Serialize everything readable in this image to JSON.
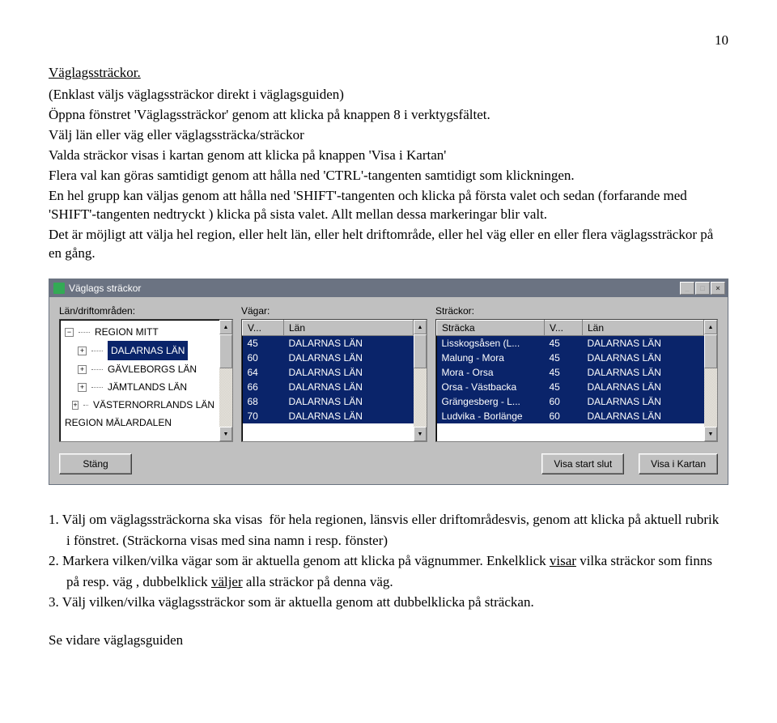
{
  "page_number": "10",
  "heading": "Väglagssträckor.",
  "intro": {
    "line1": "(Enklast väljs väglagssträckor direkt i väglagsguiden)",
    "line2": "Öppna fönstret 'Väglagssträckor' genom att klicka på knappen 8 i verktygsfältet.",
    "line3": "Välj län eller väg eller väglagssträcka/sträckor",
    "line4": "Valda sträckor visas i kartan genom att klicka på knappen 'Visa i Kartan'",
    "line5": "Flera val kan göras samtidigt genom att hålla ned 'CTRL'-tangenten samtidigt som klickningen.",
    "line6": "En hel grupp kan väljas genom att hålla ned 'SHIFT'-tangenten och klicka på första valet och sedan (forfarande med 'SHIFT'-tangenten nedtryckt ) klicka på sista valet. Allt mellan dessa markeringar blir valt.",
    "line7": "Det är möjligt att välja hel region, eller helt län, eller helt driftområde, eller hel väg eller en eller flera väglagssträckor på en gång."
  },
  "window": {
    "title": "Väglags sträckor",
    "close_glyph": "×",
    "labels": {
      "panel1": "Län/driftområden:",
      "panel2": "Vägar:",
      "panel3": "Sträckor:"
    },
    "tree": {
      "root": "REGION MITT",
      "items": [
        "DALARNAS LÄN",
        "GÄVLEBORGS LÄN",
        "JÄMTLANDS LÄN",
        "VÄSTERNORRLANDS LÄN"
      ],
      "extra": "REGION MÄLARDALEN"
    },
    "vagar": {
      "headers": [
        "V...",
        "Län"
      ],
      "rows": [
        [
          "45",
          "DALARNAS LÄN"
        ],
        [
          "60",
          "DALARNAS LÄN"
        ],
        [
          "64",
          "DALARNAS LÄN"
        ],
        [
          "66",
          "DALARNAS LÄN"
        ],
        [
          "68",
          "DALARNAS LÄN"
        ],
        [
          "70",
          "DALARNAS LÄN"
        ]
      ]
    },
    "strackor": {
      "headers": [
        "Sträcka",
        "V...",
        "Län"
      ],
      "rows": [
        [
          "Lisskogsåsen (L...",
          "45",
          "DALARNAS LÄN"
        ],
        [
          "Malung - Mora",
          "45",
          "DALARNAS LÄN"
        ],
        [
          "Mora - Orsa",
          "45",
          "DALARNAS LÄN"
        ],
        [
          "Orsa - Västbacka",
          "45",
          "DALARNAS LÄN"
        ],
        [
          "Grängesberg - L...",
          "60",
          "DALARNAS LÄN"
        ],
        [
          "Ludvika - Borlänge",
          "60",
          "DALARNAS LÄN"
        ]
      ]
    },
    "buttons": {
      "close": "Stäng",
      "show_start_stop": "Visa start slut",
      "show_map": "Visa i Kartan"
    }
  },
  "numbered": {
    "n1a": "1. Välj om väglagssträckorna ska visas  för hela regionen, länsvis eller driftområdesvis, genom att klicka på aktuell rubrik",
    "n1b": "i fönstret. (Sträckorna visas med sina namn i resp. fönster)",
    "n2a": "2. Markera vilken/vilka vägar som är aktuella genom att klicka på vägnummer. Enkelklick ",
    "n2_u1": "visar",
    "n2b": " vilka sträckor som finns",
    "n2c": "på resp. väg , dubbelklick ",
    "n2_u2": "väljer",
    "n2d": " alla sträckor på denna väg.",
    "n3": "3. Välj vilken/vilka väglagssträckor som är aktuella genom att dubbelklicka på sträckan."
  },
  "footer": "Se vidare väglagsguiden"
}
